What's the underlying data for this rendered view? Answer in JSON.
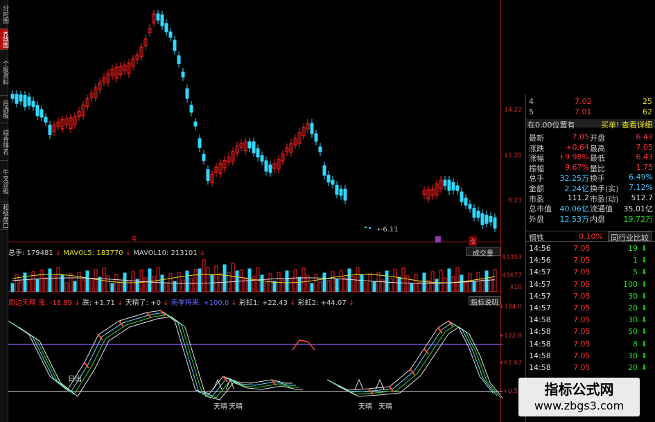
{
  "left_tabs": [
    {
      "label": "分时图",
      "active": false
    },
    {
      "label": "K线图",
      "active": true
    },
    {
      "label": "个股资料",
      "active": false
    },
    {
      "label": "自选股",
      "active": false
    },
    {
      "label": "综合排名",
      "active": false
    },
    {
      "label": "牛叉诊股",
      "active": false
    },
    {
      "label": "超级盘口",
      "active": false
    }
  ],
  "price_chart": {
    "axis_labels": [
      "14.22",
      "11.20",
      "8.23"
    ],
    "low_annotation": "6.11",
    "marker_q": "q",
    "marker_zhang": "涨"
  },
  "volume_panel": {
    "total_label": "总手: 179481",
    "mavol5_label": "MAVOL5: 183770",
    "mavol10_label": "MAVOL10: 213101",
    "indicator_button": "成交量",
    "axis_labels": [
      "91353",
      "45677",
      "X10"
    ]
  },
  "indicator_panel": {
    "items": [
      {
        "text": "周边天精 涨: -18.89",
        "color": "#ff3030"
      },
      {
        "text": "跌: +1.71",
        "color": "#d0d0d0"
      },
      {
        "text": "天精了: +0",
        "color": "#d0d0d0"
      },
      {
        "text": "雨季将来: +100.0",
        "color": "#6a6aff"
      },
      {
        "text": "彩虹1: +22.43",
        "color": "#d0d0d0"
      },
      {
        "text": "彩虹2: +44.07",
        "color": "#d0d0d0"
      }
    ],
    "explain_button": "指标说明",
    "axis_labels": [
      "+184.0",
      "+122.8",
      "+61.67",
      "+0.51"
    ],
    "annotations": [
      "日出",
      "天晴",
      "天晴",
      "天晴",
      "天晴"
    ]
  },
  "quote_panel": {
    "ask_rows": [
      {
        "level": "4",
        "price": "7.02",
        "vol": "25"
      },
      {
        "level": "5",
        "price": "7.01",
        "vol": "62"
      }
    ],
    "position_text": "在0.00位置有",
    "buy_link": "买单!",
    "detail_link": "查看详细",
    "stats": [
      {
        "l1": "最新",
        "v1": "7.05",
        "l2": "开盘",
        "v2": "6.43"
      },
      {
        "l1": "涨跌",
        "v1": "+0.64",
        "l2": "最高",
        "v2": "7.05"
      },
      {
        "l1": "涨幅",
        "v1": "+9.98%",
        "l2": "最低",
        "v2": "6.43"
      },
      {
        "l1": "振幅",
        "v1": "9.67%",
        "l2": "量比",
        "v2": "1.75"
      },
      {
        "l1": "总手",
        "v1": "32.25万",
        "l2": "换手",
        "v2": "6.49%"
      },
      {
        "l1": "金额",
        "v1": "2.24亿",
        "l2": "换手(实)",
        "v2": "7.12%"
      },
      {
        "l1": "市盈",
        "v1": "111.2",
        "l2": "市盈(动)",
        "v2": "512.7"
      },
      {
        "l1": "总市值",
        "v1": "40.06亿",
        "l2": "流通值",
        "v2": "35.01亿"
      },
      {
        "l1": "外盘",
        "v1": "12.53万",
        "l2": "内盘",
        "v2": "19.72万"
      }
    ],
    "industry_name": "钢铁",
    "industry_pct": "0.10%",
    "compare_button": "同行业比较",
    "ticks": [
      {
        "time": "14:56",
        "price": "7.05",
        "vol": "19",
        "dir": "down"
      },
      {
        "time": "14:56",
        "price": "7.05",
        "vol": "1",
        "dir": "down"
      },
      {
        "time": "14:57",
        "price": "7.05",
        "vol": "5",
        "dir": "down"
      },
      {
        "time": "14:57",
        "price": "7.05",
        "vol": "100",
        "dir": "down"
      },
      {
        "time": "14:57",
        "price": "7.05",
        "vol": "30",
        "dir": "down"
      },
      {
        "time": "14:57",
        "price": "7.05",
        "vol": "20",
        "dir": "down"
      },
      {
        "time": "14:58",
        "price": "7.05",
        "vol": "30",
        "dir": "down"
      },
      {
        "time": "14:58",
        "price": "7.05",
        "vol": "50",
        "dir": "down"
      },
      {
        "time": "14:58",
        "price": "7.05",
        "vol": "8",
        "dir": "down"
      },
      {
        "time": "14:58",
        "price": "7.05",
        "vol": "30",
        "dir": "down"
      },
      {
        "time": "14:58",
        "price": "7.05",
        "vol": "20",
        "dir": "down"
      }
    ]
  },
  "watermark": {
    "title": "指标公式网",
    "url": "www.zbgs3.com"
  },
  "colors": {
    "up": "#ff2020",
    "down": "#30d8ff",
    "value_red": "#ff3030",
    "value_green": "#20e020",
    "label_gray": "#c8c8c8"
  }
}
